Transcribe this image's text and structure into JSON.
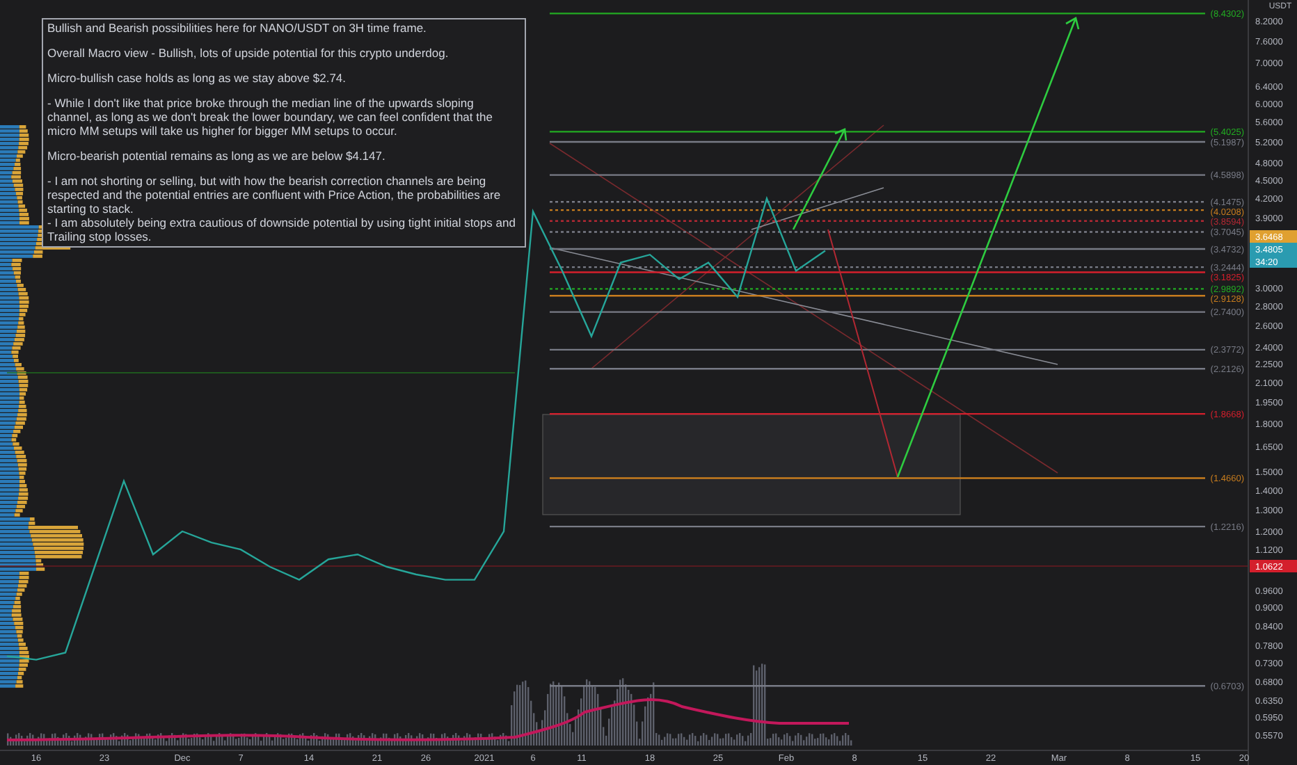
{
  "note": {
    "paragraphs": [
      {
        "text": "Bullish and Bearish possibilities here for NANO/USDT on 3H time frame.",
        "spaced": false
      },
      {
        "text": "Overall Macro view - Bullish, lots of upside potential for this crypto underdog.",
        "spaced": true
      },
      {
        "text": "Micro-bullish case holds as long as we stay above $2.74.",
        "spaced": true
      },
      {
        "text": "- While I don't like that price broke through the median line of the upwards sloping channel, as long as we don't break the lower boundary, we can feel confident that the micro MM setups will take us higher for bigger MM setups to occur.",
        "spaced": true
      },
      {
        "text": "Micro-bearish potential remains as long as we are below $4.147.",
        "spaced": true
      },
      {
        "text": "- I am not shorting or selling, but with how the bearish correction channels are being respected and the potential entries are confluent with Price Action, the probabilities are starting to stack.",
        "spaced": true
      },
      {
        "text": "- I am absolutely being extra cautious of downside potential by using tight initial stops and Trailing stop losses.",
        "spaced": false
      }
    ]
  },
  "price_axis": {
    "currency": "USDT",
    "ticks": [
      "8.2000",
      "7.6000",
      "7.0000",
      "6.4000",
      "6.0000",
      "5.6000",
      "5.2000",
      "4.8000",
      "4.5000",
      "4.2000",
      "3.9000",
      "3.0000",
      "2.8000",
      "2.6000",
      "2.4000",
      "2.2500",
      "2.1000",
      "1.9500",
      "1.8000",
      "1.6500",
      "1.5000",
      "1.4000",
      "1.3000",
      "1.2000",
      "1.1200",
      "0.9600",
      "0.9000",
      "0.8400",
      "0.7800",
      "0.7300",
      "0.6800",
      "0.6350",
      "0.5950",
      "0.5570"
    ]
  },
  "time_axis": {
    "ticks": [
      "16",
      "23",
      "Dec",
      "7",
      "14",
      "21",
      "26",
      "2021",
      "6",
      "11",
      "18",
      "25",
      "Feb",
      "8",
      "15",
      "22",
      "Mar",
      "8",
      "15",
      "20"
    ]
  },
  "levels": [
    {
      "label": "(8.4302)",
      "color": "#22ab22",
      "kind": "solid"
    },
    {
      "label": "(5.4025)",
      "color": "#22ab22",
      "kind": "solid"
    },
    {
      "label": "(5.1987)",
      "color": "#787b86",
      "kind": "solid"
    },
    {
      "label": "(4.5898)",
      "color": "#787b86",
      "kind": "solid"
    },
    {
      "label": "(4.1475)",
      "color": "#787b86",
      "kind": "dashed"
    },
    {
      "label": "(4.0208)",
      "color": "#c77c1e",
      "kind": "dashed"
    },
    {
      "label": "(3.8594)",
      "color": "#b22833",
      "kind": "dashed"
    },
    {
      "label": "(3.7045)",
      "color": "#787b86",
      "kind": "dashed"
    },
    {
      "label": "(3.4732)",
      "color": "#787b86",
      "kind": "solid"
    },
    {
      "label": "(3.2444)",
      "color": "#787b86",
      "kind": "dashed"
    },
    {
      "label": "(3.1825)",
      "color": "#d41f2c",
      "kind": "solid"
    },
    {
      "label": "(2.9892)",
      "color": "#22ab22",
      "kind": "dashed"
    },
    {
      "label": "(2.9128)",
      "color": "#c77c1e",
      "kind": "solid"
    },
    {
      "label": "(2.7400)",
      "color": "#787b86",
      "kind": "solid"
    },
    {
      "label": "(2.3772)",
      "color": "#787b86",
      "kind": "solid"
    },
    {
      "label": "(2.2126)",
      "color": "#787b86",
      "kind": "solid"
    },
    {
      "label": "(1.8668)",
      "color": "#d41f2c",
      "kind": "solid"
    },
    {
      "label": "(1.4660)",
      "color": "#c77c1e",
      "kind": "solid"
    },
    {
      "label": "(1.2216)",
      "color": "#787b86",
      "kind": "solid"
    },
    {
      "label": "(0.6703)",
      "color": "#787b86",
      "kind": "solid"
    }
  ],
  "price_badges": [
    {
      "text": "3.6468",
      "color": "#e0a030"
    },
    {
      "text": "3.4805",
      "color": "#2a9bb0"
    },
    {
      "text": "34:20",
      "color": "#2a9bb0"
    },
    {
      "text": "1.0622",
      "color": "#d41f2c"
    }
  ]
}
